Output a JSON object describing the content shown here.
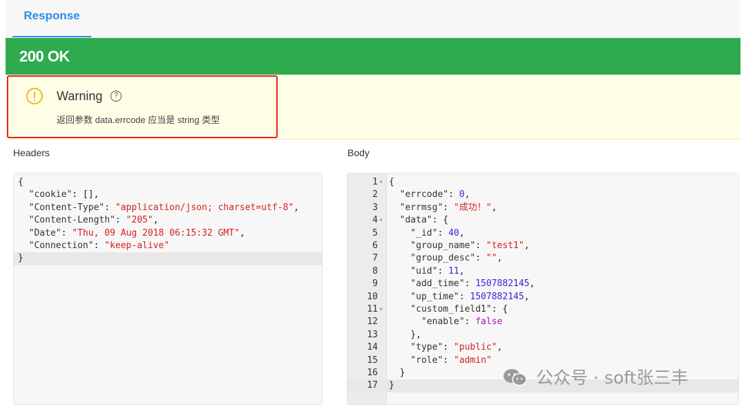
{
  "tabs": {
    "response_label": "Response"
  },
  "status": {
    "text": "200 OK",
    "color": "#2eaa4f"
  },
  "warning": {
    "title": "Warning",
    "help_glyph": "?",
    "message": "返回参数 data.errcode 应当是 string 类型",
    "icon": "alert-circle-icon"
  },
  "headers": {
    "label": "Headers",
    "lines": [
      [
        [
          "p",
          "{"
        ]
      ],
      [
        [
          "k",
          "  \"cookie\""
        ],
        [
          "p",
          ": [],"
        ]
      ],
      [
        [
          "k",
          "  \"Content-Type\""
        ],
        [
          "p",
          ": "
        ],
        [
          "s",
          "\"application/json; charset=utf-8\""
        ],
        [
          "p",
          ","
        ]
      ],
      [
        [
          "k",
          "  \"Content-Length\""
        ],
        [
          "p",
          ": "
        ],
        [
          "s",
          "\"205\""
        ],
        [
          "p",
          ","
        ]
      ],
      [
        [
          "k",
          "  \"Date\""
        ],
        [
          "p",
          ": "
        ],
        [
          "s",
          "\"Thu, 09 Aug 2018 06:15:32 GMT\""
        ],
        [
          "p",
          ","
        ]
      ],
      [
        [
          "k",
          "  \"Connection\""
        ],
        [
          "p",
          ": "
        ],
        [
          "s",
          "\"keep-alive\""
        ]
      ],
      [
        [
          "p",
          "}"
        ]
      ]
    ]
  },
  "body": {
    "label": "Body",
    "lines": [
      {
        "n": "1",
        "fold": true,
        "tokens": [
          [
            "p",
            "{"
          ]
        ]
      },
      {
        "n": "2",
        "tokens": [
          [
            "k",
            "  \"errcode\""
          ],
          [
            "p",
            ": "
          ],
          [
            "n",
            "0"
          ],
          [
            "p",
            ","
          ]
        ]
      },
      {
        "n": "3",
        "tokens": [
          [
            "k",
            "  \"errmsg\""
          ],
          [
            "p",
            ": "
          ],
          [
            "s",
            "\"成功！\""
          ],
          [
            "p",
            ","
          ]
        ]
      },
      {
        "n": "4",
        "fold": true,
        "tokens": [
          [
            "k",
            "  \"data\""
          ],
          [
            "p",
            ": {"
          ]
        ]
      },
      {
        "n": "5",
        "tokens": [
          [
            "k",
            "    \"_id\""
          ],
          [
            "p",
            ": "
          ],
          [
            "n",
            "40"
          ],
          [
            "p",
            ","
          ]
        ]
      },
      {
        "n": "6",
        "tokens": [
          [
            "k",
            "    \"group_name\""
          ],
          [
            "p",
            ": "
          ],
          [
            "s",
            "\"test1\""
          ],
          [
            "p",
            ","
          ]
        ]
      },
      {
        "n": "7",
        "tokens": [
          [
            "k",
            "    \"group_desc\""
          ],
          [
            "p",
            ": "
          ],
          [
            "s",
            "\"\""
          ],
          [
            "p",
            ","
          ]
        ]
      },
      {
        "n": "8",
        "tokens": [
          [
            "k",
            "    \"uid\""
          ],
          [
            "p",
            ": "
          ],
          [
            "n",
            "11"
          ],
          [
            "p",
            ","
          ]
        ]
      },
      {
        "n": "9",
        "tokens": [
          [
            "k",
            "    \"add_time\""
          ],
          [
            "p",
            ": "
          ],
          [
            "n",
            "1507882145"
          ],
          [
            "p",
            ","
          ]
        ]
      },
      {
        "n": "10",
        "tokens": [
          [
            "k",
            "    \"up_time\""
          ],
          [
            "p",
            ": "
          ],
          [
            "n",
            "1507882145"
          ],
          [
            "p",
            ","
          ]
        ]
      },
      {
        "n": "11",
        "fold": true,
        "tokens": [
          [
            "k",
            "    \"custom_field1\""
          ],
          [
            "p",
            ": {"
          ]
        ]
      },
      {
        "n": "12",
        "tokens": [
          [
            "k",
            "      \"enable\""
          ],
          [
            "p",
            ": "
          ],
          [
            "b",
            "false"
          ]
        ]
      },
      {
        "n": "13",
        "tokens": [
          [
            "p",
            "    },"
          ]
        ]
      },
      {
        "n": "14",
        "tokens": [
          [
            "k",
            "    \"type\""
          ],
          [
            "p",
            ": "
          ],
          [
            "s",
            "\"public\""
          ],
          [
            "p",
            ","
          ]
        ]
      },
      {
        "n": "15",
        "tokens": [
          [
            "k",
            "    \"role\""
          ],
          [
            "p",
            ": "
          ],
          [
            "s",
            "\"admin\""
          ]
        ]
      },
      {
        "n": "16",
        "tokens": [
          [
            "p",
            "  }"
          ]
        ]
      },
      {
        "n": "17",
        "tokens": [
          [
            "p",
            "}"
          ]
        ]
      }
    ]
  },
  "watermark": {
    "text": "公众号 · soft张三丰",
    "icon": "wechat-icon"
  }
}
